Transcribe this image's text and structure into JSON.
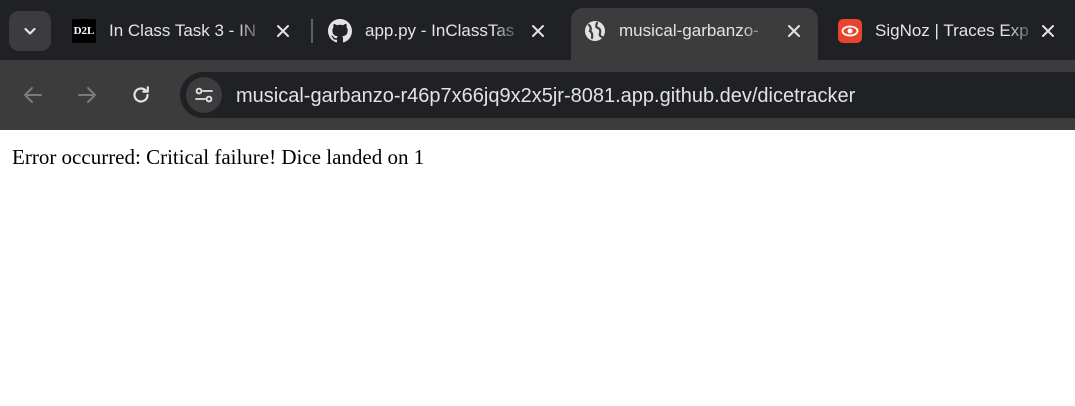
{
  "browser": {
    "tabs": [
      {
        "title": "In Class Task 3 - IN",
        "favicon": "d2l-icon",
        "favicon_text": "D2L",
        "active": false
      },
      {
        "title": "app.py - InClassTas",
        "favicon": "github-icon",
        "active": false
      },
      {
        "title": "musical-garbanzo-",
        "favicon": "globe-icon",
        "active": true
      },
      {
        "title": "SigNoz | Traces Exp",
        "favicon": "signoz-icon",
        "active": false
      }
    ],
    "url": "musical-garbanzo-r46p7x66jq9x2x5jr-8081.app.github.dev/dicetracker"
  },
  "page": {
    "message": "Error occurred: Critical failure! Dice landed on 1"
  },
  "colors": {
    "tabstrip_bg": "#202124",
    "toolbar_bg": "#3c3c3c",
    "omnibox_bg": "#202124",
    "text_light": "#e3e3e3",
    "signoz_red": "#e8432d"
  }
}
